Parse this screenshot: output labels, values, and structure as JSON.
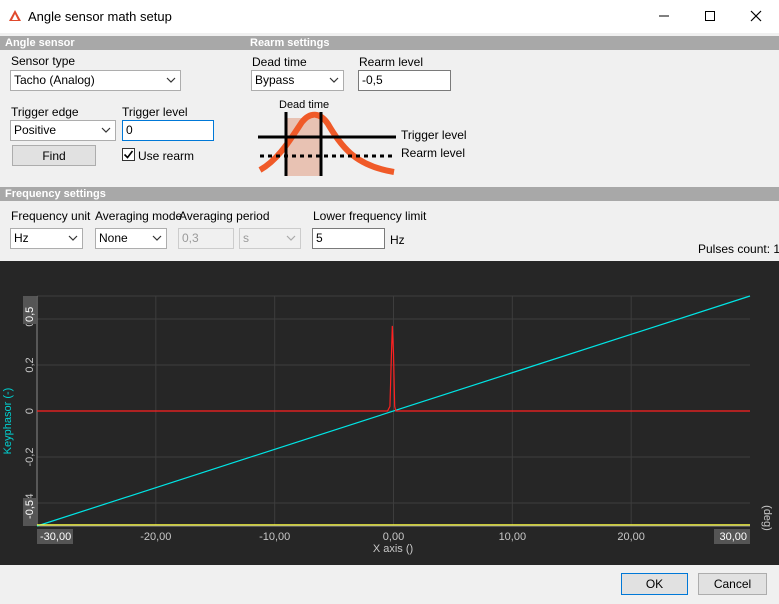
{
  "window": {
    "title": "Angle sensor math setup"
  },
  "angle_sensor": {
    "header": "Angle sensor",
    "sensor_type_label": "Sensor type",
    "sensor_type_value": "Tacho (Analog)",
    "trigger_edge_label": "Trigger edge",
    "trigger_edge_value": "Positive",
    "trigger_level_label": "Trigger level",
    "trigger_level_value": "0",
    "find_button": "Find",
    "use_rearm_label": "Use rearm",
    "use_rearm_checked": true
  },
  "rearm_settings": {
    "header": "Rearm settings",
    "dead_time_label": "Dead time",
    "dead_time_value": "Bypass",
    "rearm_level_label": "Rearm level",
    "rearm_level_value": "-0,5",
    "diagram": {
      "dead_time_caption": "Dead time",
      "trigger_level_caption": "Trigger level",
      "rearm_level_caption": "Rearm level",
      "signal_color": "#f05a28",
      "deadzone_color": "#e8c2b3"
    }
  },
  "frequency_settings": {
    "header": "Frequency settings",
    "frequency_unit_label": "Frequency unit",
    "frequency_unit_value": "Hz",
    "averaging_mode_label": "Averaging mode",
    "averaging_mode_value": "None",
    "averaging_period_label": "Averaging period",
    "averaging_period_value": "0,3",
    "averaging_period_unit": "s",
    "lower_frequency_limit_label": "Lower frequency limit",
    "lower_frequency_limit_value": "5",
    "lower_frequency_limit_unit": "Hz",
    "pulses_count": "Pulses count: 1"
  },
  "chart_data": {
    "type": "line",
    "title": "",
    "xlabel": "X axis ()",
    "x_unit": "(deg)",
    "ylabel": "Keyphasor (-)",
    "xlim": [
      -30,
      30
    ],
    "ylim": [
      -0.5,
      0.5
    ],
    "x_ticks": [
      -20,
      -10,
      0,
      10,
      20
    ],
    "x_tick_labels": [
      "-20,00",
      "-10,00",
      "0,00",
      "10,00",
      "20,00"
    ],
    "x_min_label": "-30,00",
    "x_max_label": "30,00",
    "y_ticks": [
      0.4,
      0.2,
      0,
      -0.2,
      -0.4
    ],
    "y_tick_labels": [
      "0,4",
      "0,2",
      "0",
      "-0,2",
      "-0,4"
    ],
    "y_max_label": "0,5",
    "y_min_label": "-0,5",
    "grid": true,
    "series": [
      {
        "color": "#00e5e5",
        "x": [
          -30,
          30
        ],
        "y": [
          -0.5,
          0.5
        ]
      },
      {
        "color": "#ff2020",
        "x": [
          -30,
          -0.5,
          -0.3,
          -0.2,
          -0.1,
          0,
          0.1,
          0.2,
          30
        ],
        "y": [
          0,
          0,
          0.02,
          0.2,
          0.37,
          0.25,
          0.02,
          0,
          0
        ]
      },
      {
        "color": "#ffff40",
        "x": [
          -30,
          30
        ],
        "y": [
          -0.495,
          -0.495
        ]
      }
    ]
  },
  "footer": {
    "ok_button": "OK",
    "cancel_button": "Cancel"
  }
}
